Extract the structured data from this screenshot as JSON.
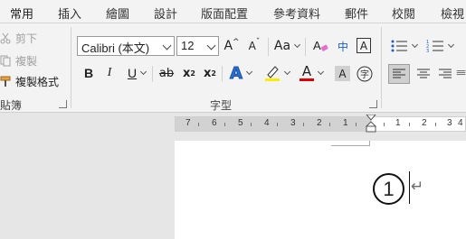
{
  "tabs": [
    "常用",
    "插入",
    "繪圖",
    "設計",
    "版面配置",
    "參考資料",
    "郵件",
    "校閱",
    "檢視"
  ],
  "clipboard": {
    "cut": "剪下",
    "copy": "複製",
    "format_painter": "複製格式",
    "group_label": "貼簿"
  },
  "font": {
    "font_name": "Calibri (本文)",
    "font_size": "12",
    "grow_label": "A",
    "shrink_label": "A",
    "case_label": "Aa",
    "bold": "B",
    "italic": "I",
    "underline": "U",
    "strike": "ab",
    "subscript": "x",
    "subscript_mark": "2",
    "superscript": "x",
    "superscript_mark": "2",
    "text_effect": "A",
    "font_color": "A",
    "char_shading": "A",
    "phonetic": "中",
    "group_label": "字型",
    "highlight_color": "#ffeb00",
    "font_color_value": "#e00000"
  },
  "ruler": {
    "numbers_left": [
      "7",
      "6",
      "5",
      "4",
      "3",
      "2",
      "1"
    ],
    "numbers_right": [
      "1",
      "2",
      "3",
      "4"
    ]
  },
  "document": {
    "content": "1",
    "paragraph_mark": "↵"
  }
}
